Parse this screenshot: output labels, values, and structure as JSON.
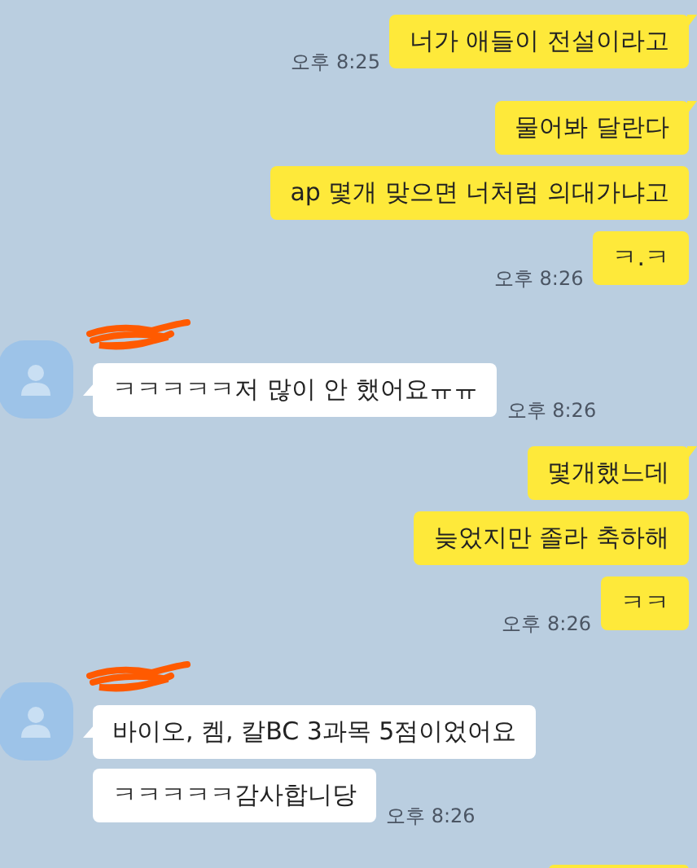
{
  "groups": [
    {
      "kind": "sent",
      "messages": [
        {
          "text": "너가 애들이 전설이라고",
          "time": "오후 8:25"
        }
      ]
    },
    {
      "kind": "sent",
      "messages": [
        {
          "text": "물어봐 달란다"
        },
        {
          "text": "ap 몇개 맞으면 너처럼 의대가냐고"
        },
        {
          "text": "ㅋ.ㅋ",
          "time": "오후 8:26"
        }
      ]
    },
    {
      "kind": "received",
      "messages": [
        {
          "text": "ㅋㅋㅋㅋㅋ저 많이 안 했어요ㅠㅠ",
          "time": "오후 8:26"
        }
      ]
    },
    {
      "kind": "sent",
      "messages": [
        {
          "text": "몇개했느데"
        },
        {
          "text": "늦었지만 졸라 축하해"
        },
        {
          "text": "ㅋㅋ",
          "time": "오후 8:26"
        }
      ]
    },
    {
      "kind": "received",
      "messages": [
        {
          "text": "바이오, 켐, 칼BC 3과목 5점이었어요"
        },
        {
          "text": "ㅋㅋㅋㅋㅋ감사합니당",
          "time": "오후 8:26"
        }
      ]
    },
    {
      "kind": "sent",
      "messages": [
        {
          "kind": "cut-off"
        }
      ]
    }
  ]
}
